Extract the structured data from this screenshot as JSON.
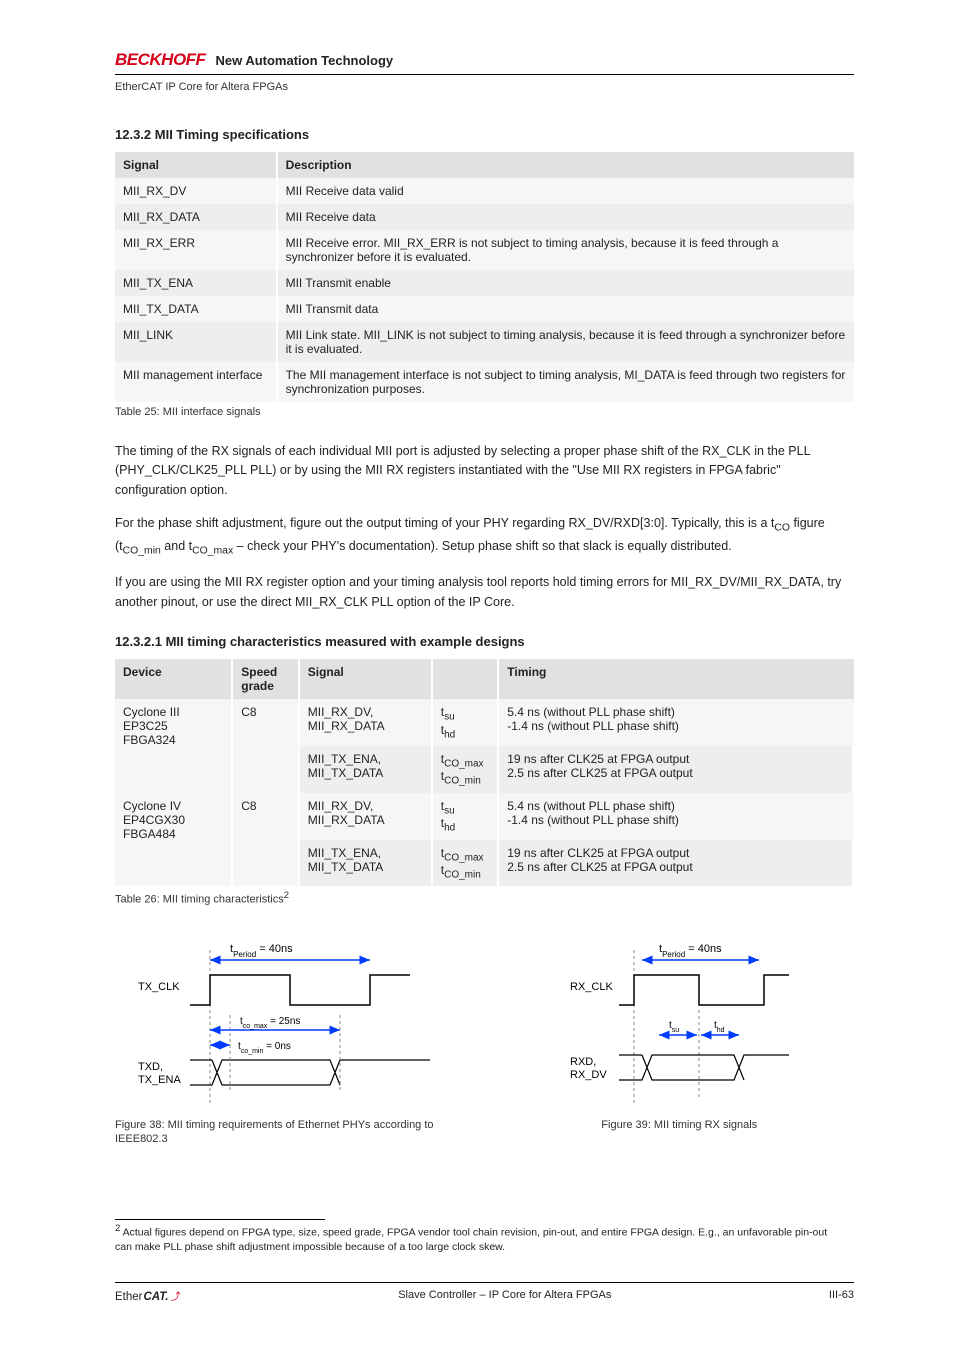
{
  "header": {
    "brand": "BECKHOFF",
    "tagline": "New Automation Technology",
    "doc_title_top": "EtherCAT IP Core for Altera FPGAs"
  },
  "section1": {
    "heading": "12.3.2 MII Timing specifications",
    "table": {
      "head": [
        "Signal",
        "Description"
      ],
      "rows": [
        [
          "MII_RX_DV",
          "MII Receive data valid"
        ],
        [
          "MII_RX_DATA",
          "MII Receive data"
        ],
        [
          "MII_RX_ERR",
          "MII Receive error. MII_RX_ERR is not subject to timing analysis, because it is feed through a synchronizer before it is evaluated."
        ],
        [
          "MII_TX_ENA",
          "MII Transmit enable"
        ],
        [
          "MII_TX_DATA",
          "MII Transmit data"
        ],
        [
          "MII_LINK",
          "MII Link state. MII_LINK is not subject to timing analysis, because it is feed through a synchronizer before it is evaluated."
        ],
        [
          "MII management interface",
          "The MII management interface is not subject to timing analysis, MI_DATA is feed through two registers for synchronization purposes."
        ]
      ],
      "caption": "Table 25: MII interface signals"
    },
    "p1": "The timing of the RX signals of each individual MII port is adjusted by selecting a proper phase shift of the RX_CLK in the PLL (PHY_CLK/CLK25_PLL PLL) or by using the MII RX registers instantiated with the ",
    "p1_code": "\"Use MII RX registers in FPGA fabric\"",
    "p1_b": " configuration option.",
    "p2_a": "For the phase shift adjustment, figure out the output timing of your PHY regarding RX_DV/RXD[3:0]. Typically, this is a t",
    "p2_sub1": "CO",
    "p2_b": " figure (t",
    "p2_sub2": "CO_min",
    "p2_c": " and t",
    "p2_sub3": "CO_max",
    "p2_d": " – check your PHY's documentation). Setup phase shift so that slack is equally distributed.",
    "p3": "If you are using the MII RX register option and your timing analysis tool reports hold timing errors for MII_RX_DV/MII_RX_DATA, try another pinout, or use the direct MII_RX_CLK PLL option of the IP Core."
  },
  "section2": {
    "heading": "12.3.2.1 MII timing characteristics measured with example designs",
    "table": {
      "head": [
        "Device",
        "Speed grade",
        "Signal",
        "",
        "Timing"
      ],
      "rows": [
        [
          [
            "Cyclone III",
            "EP3C25",
            "FBGA324"
          ],
          [
            "C8"
          ],
          [
            "MII_RX_DV,",
            "MII_RX_DATA"
          ],
          [
            "t",
            "su",
            "t",
            "hd"
          ],
          [
            "5.4 ns (without PLL phase shift)",
            "-1.4 ns (without PLL phase shift)"
          ]
        ],
        [
          [
            ""
          ],
          [
            ""
          ],
          [
            "MII_TX_ENA,",
            "MII_TX_DATA"
          ],
          [
            "t",
            "CO_max",
            "t",
            "CO_min"
          ],
          [
            "19 ns after CLK25 at FPGA output",
            "2.5 ns after CLK25 at FPGA output"
          ]
        ],
        [
          [
            "Cyclone IV",
            "EP4CGX30",
            "FBGA484"
          ],
          [
            "C8"
          ],
          [
            "MII_RX_DV,",
            "MII_RX_DATA"
          ],
          [
            "t",
            "su",
            "t",
            "hd"
          ],
          [
            "5.4 ns (without PLL phase shift)",
            "-1.4 ns (without PLL phase shift)"
          ]
        ],
        [
          [
            ""
          ],
          [
            ""
          ],
          [
            "MII_TX_ENA,",
            "MII_TX_DATA"
          ],
          [
            "t",
            "CO_max",
            "t",
            "CO_min"
          ],
          [
            "19 ns after CLK25 at FPGA output",
            "2.5 ns after CLK25 at FPGA output"
          ]
        ]
      ],
      "caption_a": "Table 26: MII timing characteristics",
      "caption_sup": "2"
    },
    "fig_left": {
      "t_period": "t",
      "period_sub": "Period",
      "eq_period": "= 40ns",
      "tco_max": "t",
      "tcomax_sub": "co_max",
      "eq_max": "= 25ns",
      "tco_min": "t",
      "tcomin_sub": "co_min",
      "eq_min": "= 0ns",
      "tx_clk": "TX_CLK",
      "txd": "TXD,",
      "txena": "TX_ENA",
      "caption": "Figure 38: MII timing requirements of Ethernet PHYs according to IEEE802.3"
    },
    "fig_right": {
      "t_period": "t",
      "period_sub": "Period",
      "eq_period": "= 40ns",
      "tsu": "t",
      "tsu_sub": "su",
      "thd": "t",
      "thd_sub": "hd",
      "rx_clk": "RX_CLK",
      "rxd": "RXD,",
      "rxdv": "RX_DV",
      "caption": "Figure 39: MII timing RX signals"
    }
  },
  "footnote": {
    "marker": "2",
    "text": " Actual figures depend on FPGA type, size, speed grade, FPGA vendor tool chain revision, pin-out, and entire FPGA design. E.g., an unfavorable pin-out can make PLL phase shift adjustment impossible because of a too large clock skew."
  },
  "footer": {
    "center": "Slave Controller – IP Core for Altera FPGAs",
    "right": "III-63"
  }
}
